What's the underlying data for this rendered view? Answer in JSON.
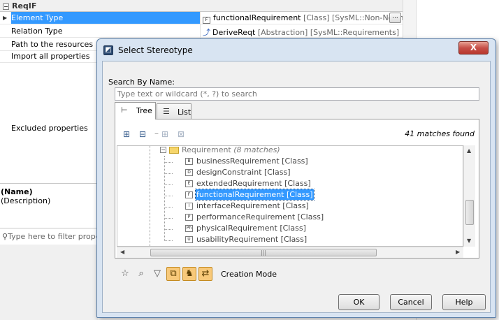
{
  "background": {
    "section_title": "ReqIF",
    "properties": [
      {
        "name": "Element Type",
        "value": "functionalRequirement",
        "meta": "[Class] [SysML::Non-Norm…",
        "selected": true
      },
      {
        "name": "Relation Type",
        "value": "DeriveReqt",
        "meta": "[Abstraction] [SysML::Requirements]"
      },
      {
        "name": "Path to the resources",
        "value": ""
      },
      {
        "name": "Import all properties",
        "value": ""
      }
    ],
    "ellipsis_label": "...",
    "excluded_label": "Excluded properties",
    "description_name": "(Name)",
    "description_text": "(Description)",
    "filter_placeholder": "Type here to filter prope"
  },
  "dialog": {
    "title": "Select Stereotype",
    "close_label": "X",
    "search_label": "Search By Name:",
    "search_placeholder": "Type text or wildcard (*, ?) to search",
    "tabs": [
      {
        "label": "Tree",
        "active": true
      },
      {
        "label": "List",
        "active": false
      }
    ],
    "matches_text": "41 matches found",
    "tree": {
      "folder": {
        "name": "Requirement",
        "count": "(8 matches)"
      },
      "items": [
        {
          "label": "businessRequirement [Class]",
          "icon": "B"
        },
        {
          "label": "designConstraint [Class]",
          "icon": "D"
        },
        {
          "label": "extendedRequirement [Class]",
          "icon": "E"
        },
        {
          "label": "functionalRequirement [Class]",
          "icon": "F",
          "selected": true
        },
        {
          "label": "interfaceRequirement [Class]",
          "icon": "I"
        },
        {
          "label": "performanceRequirement [Class]",
          "icon": "P"
        },
        {
          "label": "physicalRequirement [Class]",
          "icon": "Ph"
        },
        {
          "label": "usabilityRequirement [Class]",
          "icon": "U"
        }
      ]
    },
    "creation_mode_label": "Creation Mode",
    "buttons": {
      "ok": "OK",
      "cancel": "Cancel",
      "help": "Help"
    }
  }
}
